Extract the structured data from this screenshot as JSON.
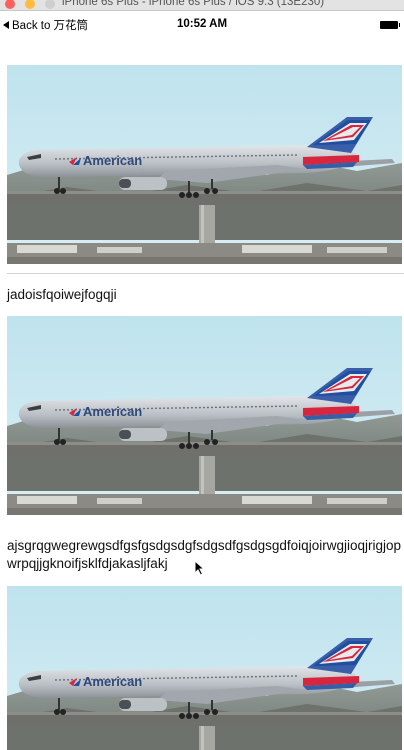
{
  "window": {
    "title": "iPhone 6s Plus - iPhone 6s Plus / iOS 9.3 (13E230)"
  },
  "status_bar": {
    "back_label": "Back to 万花筒",
    "time": "10:52 AM"
  },
  "posts": [
    {
      "image": "airplane-photo",
      "caption": "jadoisfqoiwejfogqji"
    },
    {
      "image": "airplane-photo",
      "caption": "ajsgrqgwegrewgsdfgsfgsdgsdgfsdgsdfgsdgsgdfoiqjoirwgjioqjrigjopwrpqjjgknoifjsklfdjakasljfakj"
    },
    {
      "image": "airplane-photo",
      "caption": ""
    }
  ],
  "photo_label": "American",
  "colors": {
    "sky": "#cfe6ef",
    "fuselage": "#c9ced3",
    "tail_red": "#d7263d",
    "tail_blue": "#1e4fa1"
  }
}
